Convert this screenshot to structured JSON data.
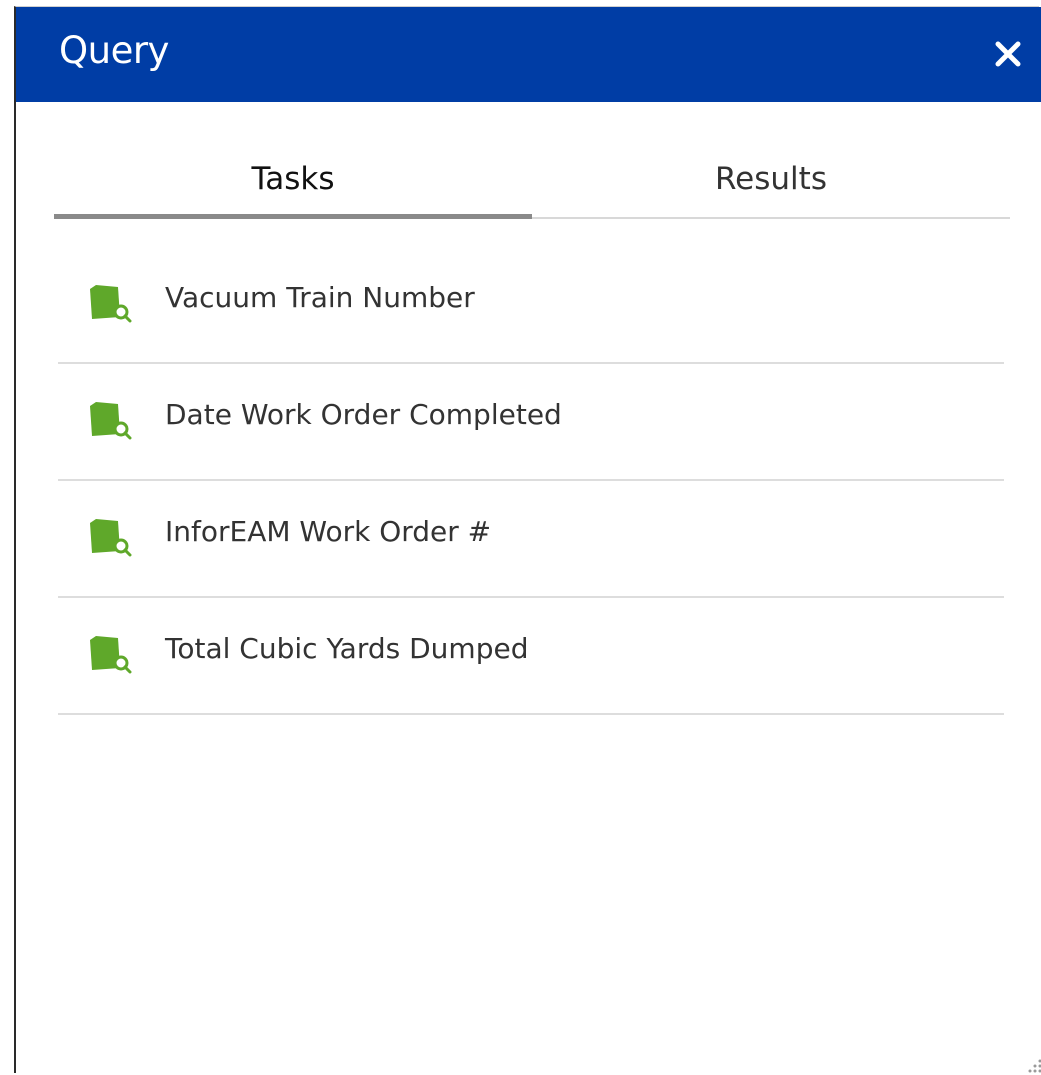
{
  "window": {
    "title": "Query",
    "close_icon": "close-icon"
  },
  "tabs": [
    {
      "label": "Tasks",
      "active": true
    },
    {
      "label": "Results",
      "active": false
    }
  ],
  "tasks": [
    {
      "label": "Vacuum Train Number",
      "icon": "query-layer-icon"
    },
    {
      "label": "Date Work Order Completed",
      "icon": "query-layer-icon"
    },
    {
      "label": "InforEAM Work Order #",
      "icon": "query-layer-icon"
    },
    {
      "label": "Total Cubic Yards Dumped",
      "icon": "query-layer-icon"
    }
  ],
  "colors": {
    "title_bar": "#003da5",
    "icon_green": "#5fa82a"
  }
}
